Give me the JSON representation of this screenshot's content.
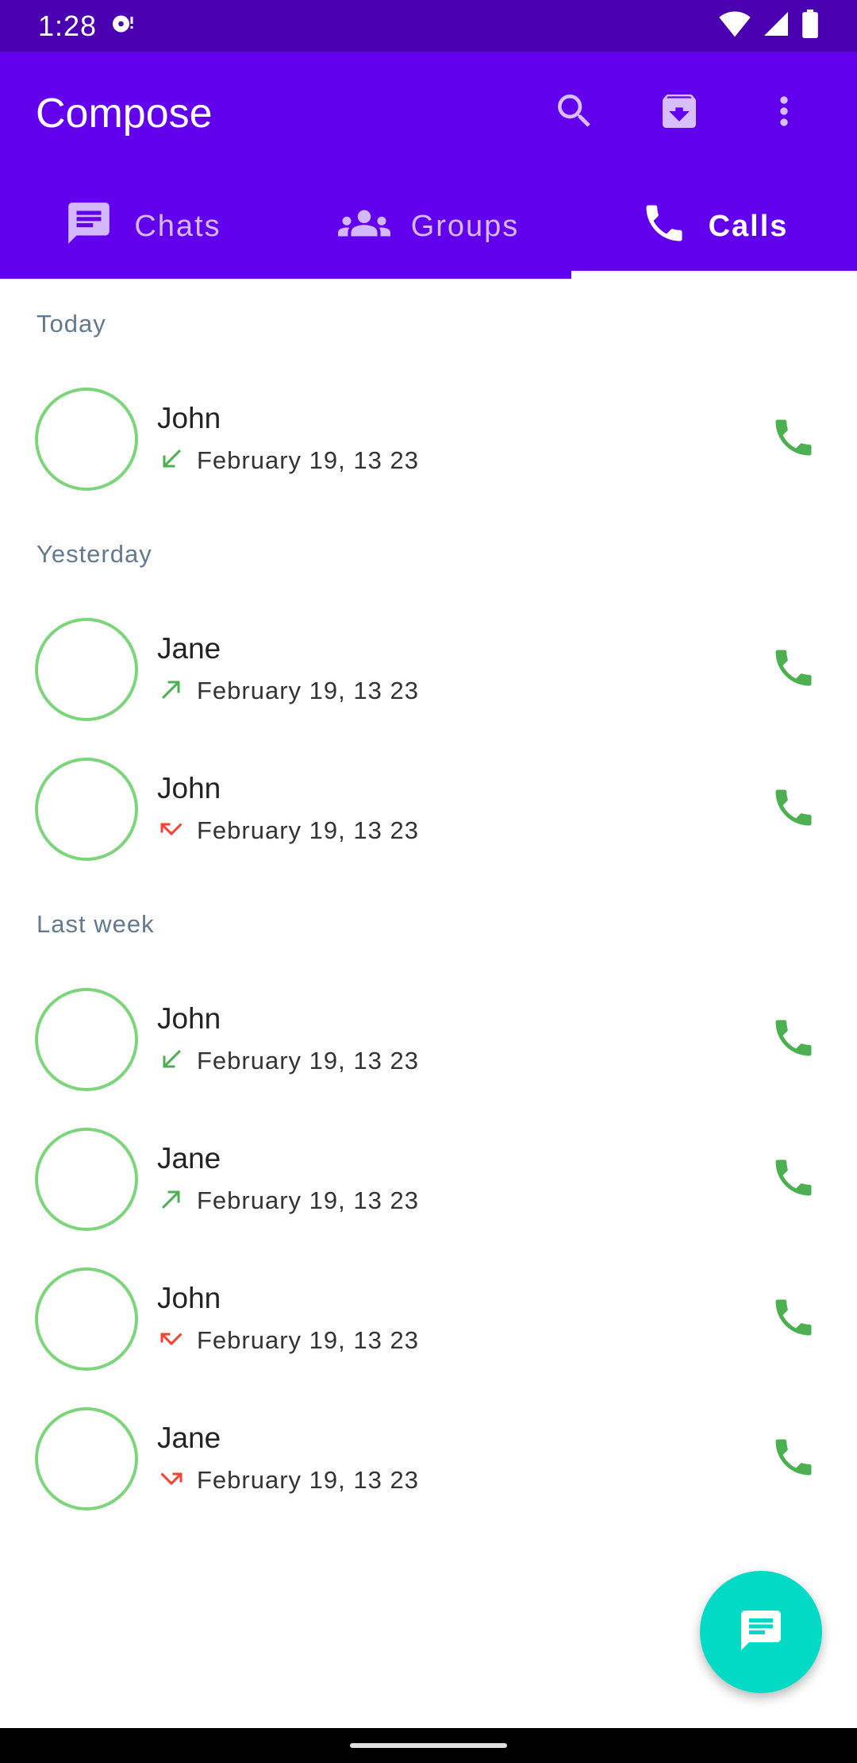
{
  "status_bar": {
    "time": "1:28",
    "icons": [
      "notification-icon",
      "wifi-icon",
      "signal-icon",
      "battery-icon"
    ]
  },
  "app_bar": {
    "title": "Compose",
    "actions": [
      "search-icon",
      "archive-icon",
      "more-vert-icon"
    ]
  },
  "tabs": [
    {
      "label": "Chats",
      "icon": "chat-icon",
      "active": false
    },
    {
      "label": "Groups",
      "icon": "groups-icon",
      "active": false
    },
    {
      "label": "Calls",
      "icon": "phone-icon",
      "active": true
    }
  ],
  "sections": [
    {
      "header": "Today",
      "calls": [
        {
          "name": "John",
          "date": "February 19, 13 23",
          "type": "incoming"
        }
      ]
    },
    {
      "header": "Yesterday",
      "calls": [
        {
          "name": "Jane",
          "date": "February 19, 13 23",
          "type": "outgoing"
        },
        {
          "name": "John",
          "date": "February 19, 13 23",
          "type": "missed"
        }
      ]
    },
    {
      "header": "Last week",
      "calls": [
        {
          "name": "John",
          "date": "February 19, 13 23",
          "type": "incoming"
        },
        {
          "name": "Jane",
          "date": "February 19, 13 23",
          "type": "outgoing"
        },
        {
          "name": "John",
          "date": "February 19, 13 23",
          "type": "missed"
        },
        {
          "name": "Jane",
          "date": "February 19, 13 23",
          "type": "missed-outgoing"
        }
      ]
    }
  ],
  "fab": {
    "icon": "message-icon"
  },
  "colors": {
    "status_bar": "#4a00b0",
    "primary": "#6200ee",
    "accent": "#03dac5",
    "call_green": "#4caf50",
    "missed_red": "#f44336",
    "avatar_border": "#7dd57b",
    "section_header": "#62798f"
  }
}
